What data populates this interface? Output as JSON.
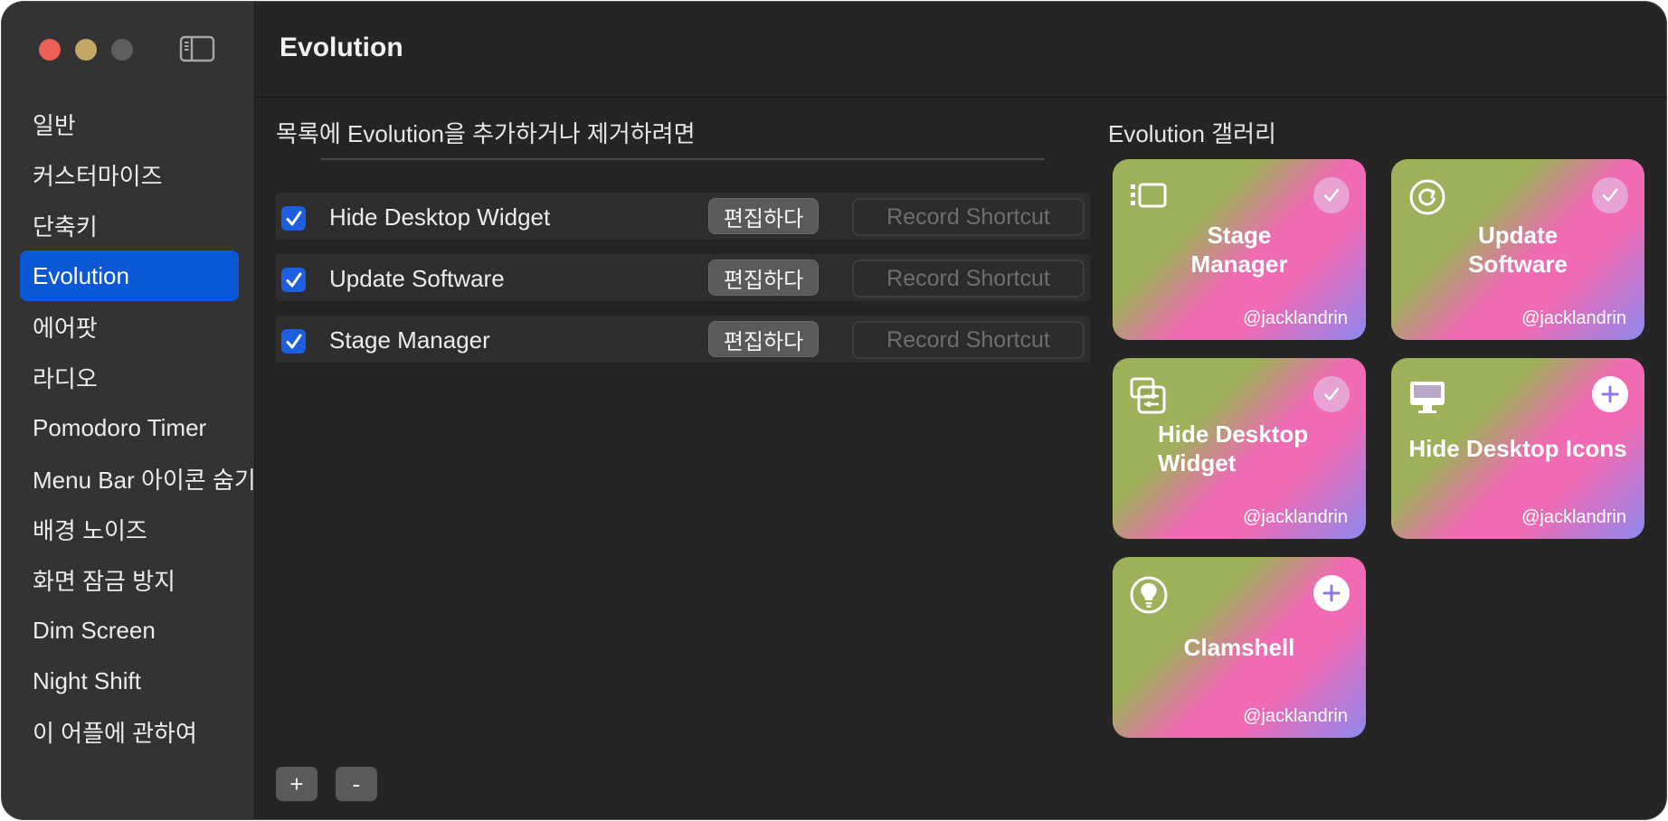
{
  "window": {
    "title": "Evolution"
  },
  "sidebar": {
    "items": [
      {
        "label": "일반"
      },
      {
        "label": "커스터마이즈"
      },
      {
        "label": "단축키"
      },
      {
        "label": "Evolution",
        "active": true
      },
      {
        "label": "에어팟"
      },
      {
        "label": "라디오"
      },
      {
        "label": "Pomodoro Timer"
      },
      {
        "label": "Menu Bar 아이콘 숨기기"
      },
      {
        "label": "배경 노이즈"
      },
      {
        "label": "화면 잠금 방지"
      },
      {
        "label": "Dim Screen"
      },
      {
        "label": "Night Shift"
      },
      {
        "label": "이 어플에 관하여"
      }
    ]
  },
  "list": {
    "heading": "목록에 Evolution을 추가하거나 제거하려면",
    "rows": [
      {
        "label": "Hide Desktop Widget",
        "checked": true,
        "edit_label": "편집하다",
        "shortcut_label": "Record Shortcut"
      },
      {
        "label": "Update Software",
        "checked": true,
        "edit_label": "편집하다",
        "shortcut_label": "Record Shortcut"
      },
      {
        "label": "Stage Manager",
        "checked": true,
        "edit_label": "편집하다",
        "shortcut_label": "Record Shortcut"
      }
    ],
    "add_label": "+",
    "remove_label": "-"
  },
  "gallery": {
    "heading": "Evolution 갤러리",
    "cards": [
      {
        "title": "Stage Manager",
        "author": "@jacklandrin",
        "icon": "stage-manager-icon",
        "status": "added"
      },
      {
        "title": "Update Software",
        "author": "@jacklandrin",
        "icon": "refresh-icon",
        "status": "added"
      },
      {
        "title": "Hide Desktop Widget",
        "author": "@jacklandrin",
        "icon": "widget-icon",
        "status": "added"
      },
      {
        "title": "Hide Desktop Icons",
        "author": "@jacklandrin",
        "icon": "monitor-icon",
        "status": "available"
      },
      {
        "title": "Clamshell",
        "author": "@jacklandrin",
        "icon": "lightbulb-icon",
        "status": "available"
      }
    ]
  },
  "colors": {
    "accent": "#0a58d6",
    "checkbox": "#1d5fe0",
    "traffic_close": "#ed5f56",
    "traffic_minimize": "#c4a867",
    "traffic_zoom": "#5e5e5e"
  }
}
